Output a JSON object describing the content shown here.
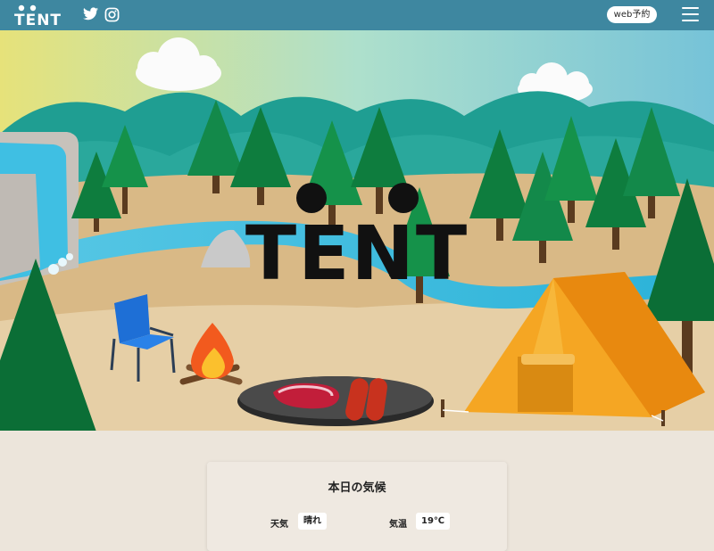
{
  "header": {
    "logo_text": "TENT",
    "twitter_icon": "twitter-icon",
    "instagram_icon": "instagram-icon",
    "web_button_label": "web予約",
    "menu_icon": "hamburger-menu-icon"
  },
  "hero": {
    "logo_text": "TENT"
  },
  "weather": {
    "title": "本日の気候",
    "weather_label": "天気",
    "weather_value": "晴れ",
    "temp_label": "気温",
    "temp_value": "19℃"
  },
  "colors": {
    "header_bg": "#3e87a0",
    "page_bg": "#ece5db",
    "tent": "#f5a623"
  }
}
